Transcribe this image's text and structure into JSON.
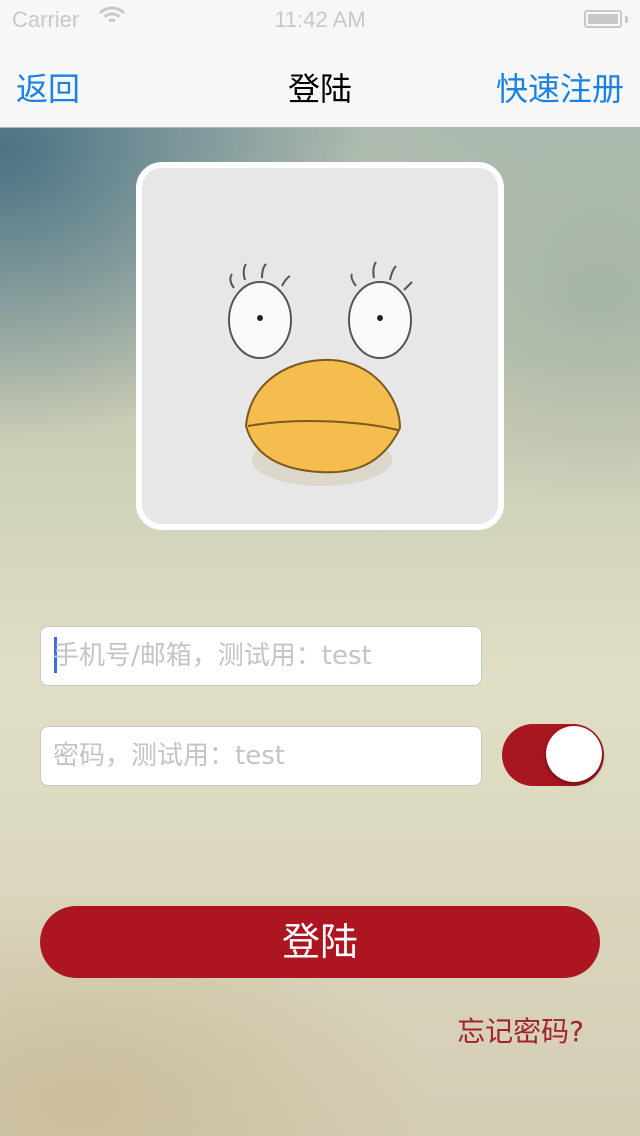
{
  "status_bar": {
    "carrier": "Carrier",
    "time": "11:42 AM",
    "wifi_icon": "wifi-icon",
    "battery_icon": "battery-icon"
  },
  "nav": {
    "back_label": "返回",
    "title": "登陆",
    "register_label": "快速注册"
  },
  "avatar": {
    "icon": "duck-face-avatar"
  },
  "form": {
    "account_placeholder": "手机号/邮箱，测试用：test",
    "account_value": "",
    "password_placeholder": "密码，测试用：test",
    "password_value": "",
    "toggle_on": true
  },
  "login_button_label": "登陆",
  "forgot_label": "忘记密码?",
  "colors": {
    "accent_blue": "#1a82e2",
    "primary_red": "#ad1620",
    "link_red": "#a4222a"
  }
}
